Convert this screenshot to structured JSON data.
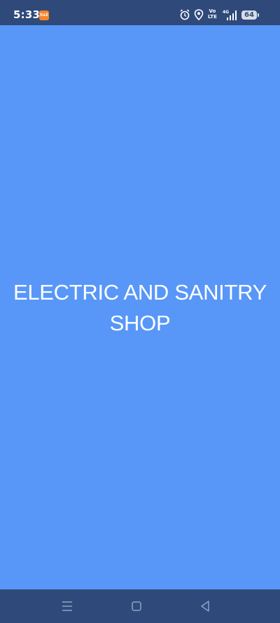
{
  "status_bar": {
    "time": "5:33",
    "notification_label": "tu2",
    "volte_top": "Vo",
    "volte_bottom": "LTE",
    "network_label": "4G",
    "battery_level": "64"
  },
  "splash": {
    "title": "ELECTRIC AND SANITRY SHOP"
  },
  "colors": {
    "background": "#5897f8",
    "bars": "#2f4a7a",
    "text": "#ffffff"
  },
  "nav_bar": {
    "buttons": [
      "menu-icon",
      "home-icon",
      "back-icon"
    ]
  }
}
